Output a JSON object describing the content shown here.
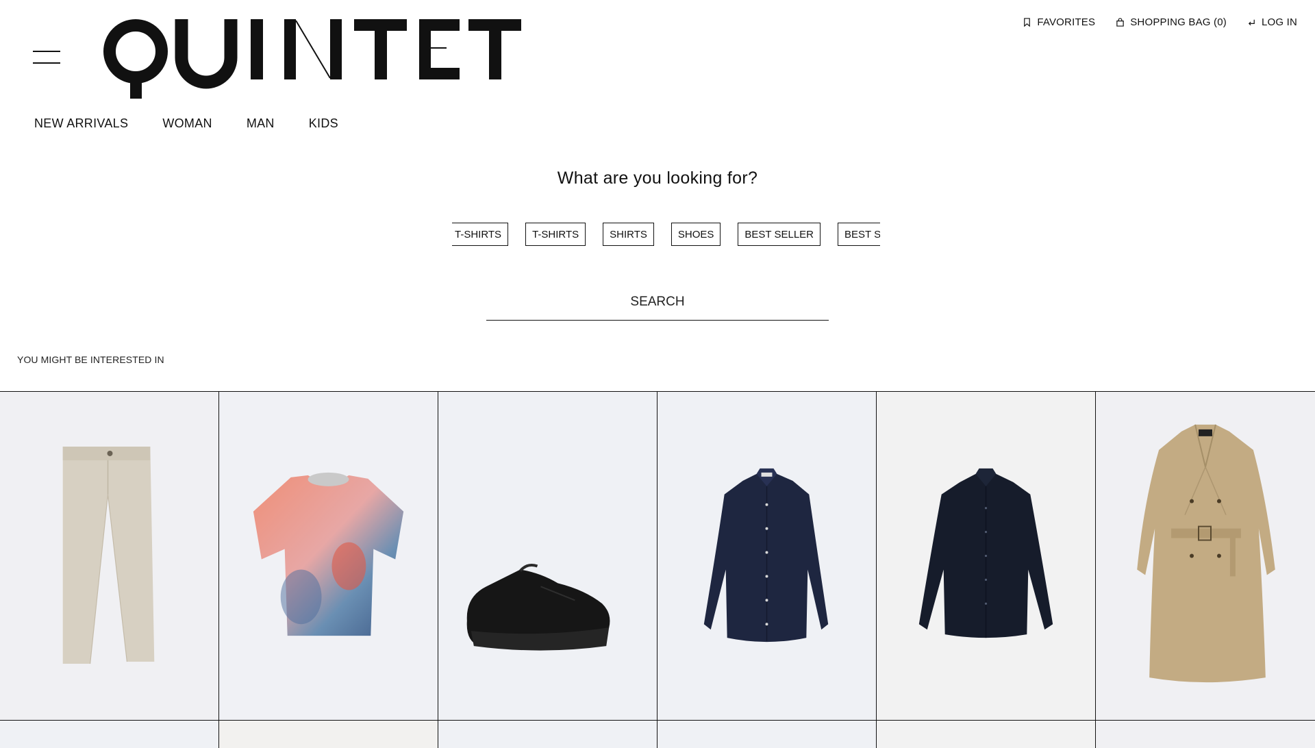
{
  "header": {
    "logo_text": "QUINTET",
    "menu_icon": "hamburger-menu-icon",
    "links": [
      {
        "label": "FAVORITES",
        "icon": "bookmark-icon"
      },
      {
        "label": "SHOPPING BAG (0)",
        "icon": "shopping-bag-icon"
      },
      {
        "label": "LOG IN",
        "icon": "login-arrow-icon"
      }
    ]
  },
  "nav": {
    "items": [
      "NEW ARRIVALS",
      "WOMAN",
      "MAN",
      "KIDS"
    ]
  },
  "search": {
    "heading": "What are you looking for?",
    "tags": [
      "T-SHIRTS",
      "T-SHIRTS",
      "SHIRTS",
      "SHOES",
      "BEST SELLER",
      "BEST SELLER"
    ],
    "placeholder": "SEARCH"
  },
  "recommendations": {
    "title": "YOU MIGHT BE INTERESTED IN",
    "products": [
      {
        "image": "beige-trousers",
        "bg": "#f0f0f3"
      },
      {
        "image": "printed-tshirt",
        "bg": "#f0f1f5"
      },
      {
        "image": "black-sneaker",
        "bg": "#eff1f5"
      },
      {
        "image": "navy-shirt",
        "bg": "#eff1f5"
      },
      {
        "image": "dark-navy-shirt",
        "bg": "#f2f2f2"
      },
      {
        "image": "trench-coat",
        "bg": "#f0f0f3"
      }
    ]
  },
  "colors": {
    "text": "#111111",
    "background": "#ffffff",
    "border": "#111111"
  }
}
